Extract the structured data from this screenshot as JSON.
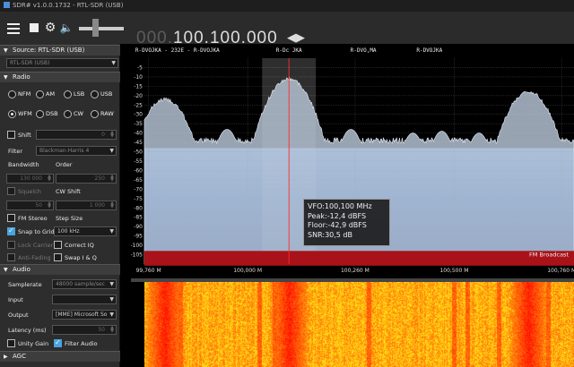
{
  "window": {
    "title": "SDR# v1.0.0.1732 - RTL-SDR (USB)"
  },
  "toolbar": {
    "menu_icon": "hamburger-icon",
    "stop_icon": "stop-icon",
    "settings_icon": "gear-icon",
    "volume_icon": "speaker-icon",
    "volume_level": 0.35,
    "frequency_dim": "000.",
    "frequency_lit": "100.100.000",
    "tune_arrows": "◀▶"
  },
  "source": {
    "header": "Source: RTL-SDR (USB)",
    "device": "RTL-SDR (USB)"
  },
  "radio": {
    "header": "Radio",
    "modes_row1": [
      "NFM",
      "AM",
      "LSB",
      "USB"
    ],
    "modes_row2": [
      "WFM",
      "DSB",
      "CW",
      "RAW"
    ],
    "selected_mode": "WFM",
    "shift_label": "Shift",
    "shift_value": "0",
    "filter_label": "Filter",
    "filter_value": "Blackman-Harris 4",
    "bandwidth_label": "Bandwidth",
    "bandwidth_value": "130 000",
    "order_label": "Order",
    "order_value": "250",
    "squelch_label": "Squelch",
    "squelch_value": "50",
    "cw_shift_label": "CW Shift",
    "cw_shift_value": "1 000",
    "fm_stereo_label": "FM Stereo",
    "step_size_label": "Step Size",
    "snap_label": "Snap to Grid",
    "step_value": "100 kHz",
    "lock_carrier_label": "Lock Carrier",
    "correct_iq_label": "Correct IQ",
    "anti_fading_label": "Anti-Fading",
    "swap_iq_label": "Swap I & Q"
  },
  "audio": {
    "header": "Audio",
    "samplerate_label": "Samplerate",
    "samplerate_value": "48000 sample/sec",
    "input_label": "Input",
    "input_value": "",
    "output_label": "Output",
    "output_value": "[MME] Microsoft So",
    "latency_label": "Latency (ms)",
    "latency_value": "50",
    "unity_gain_label": "Unity Gain",
    "filter_audio_label": "Filter Audio"
  },
  "agc": {
    "header": "AGC"
  },
  "chart_data": {
    "type": "area",
    "title": "",
    "ylim": [
      -110,
      0
    ],
    "y_ticks": [
      -5,
      -10,
      -15,
      -20,
      -25,
      -30,
      -35,
      -40,
      -45,
      -50,
      -55,
      -60,
      -65,
      -70,
      -75,
      -80,
      -85,
      -90,
      -95,
      -100,
      -105
    ],
    "xlim": [
      99.75,
      100.79
    ],
    "x_ticks": [
      {
        "value": 99.76,
        "label": "99,760 M"
      },
      {
        "value": 100.0,
        "label": "100,000 M"
      },
      {
        "value": 100.26,
        "label": "100,260 M"
      },
      {
        "value": 100.5,
        "label": "100,500 M"
      },
      {
        "value": 100.76,
        "label": "100,760 M"
      }
    ],
    "station_labels": [
      {
        "freq": 99.83,
        "text": "R-DVOJKA - 232E - R-DVOJKA"
      },
      {
        "freq": 100.1,
        "text": "R-Dc JKA"
      },
      {
        "freq": 100.28,
        "text": "R-DVO,MA"
      },
      {
        "freq": 100.44,
        "text": "R-DVOJKA"
      }
    ],
    "band_label": "FM Broadcast",
    "vfo_mhz": 100.1,
    "filter_bandwidth_khz": 130,
    "floor_db": -44,
    "peaks": [
      {
        "freq": 99.8,
        "db": -22
      },
      {
        "freq": 100.1,
        "db": -11
      },
      {
        "freq": 100.68,
        "db": -18
      }
    ],
    "colors": {
      "spectrum_fill": "#b9c7d8",
      "vfo_line": "#ff2b2b",
      "band_bar": "#a81218"
    }
  },
  "tooltip": {
    "vfo": "VFO:100,100 MHz",
    "peak": "Peak:-12,4 dBFS",
    "floor": "Floor:-42,9 dBFS",
    "snr": "SNR:30,5 dB"
  }
}
